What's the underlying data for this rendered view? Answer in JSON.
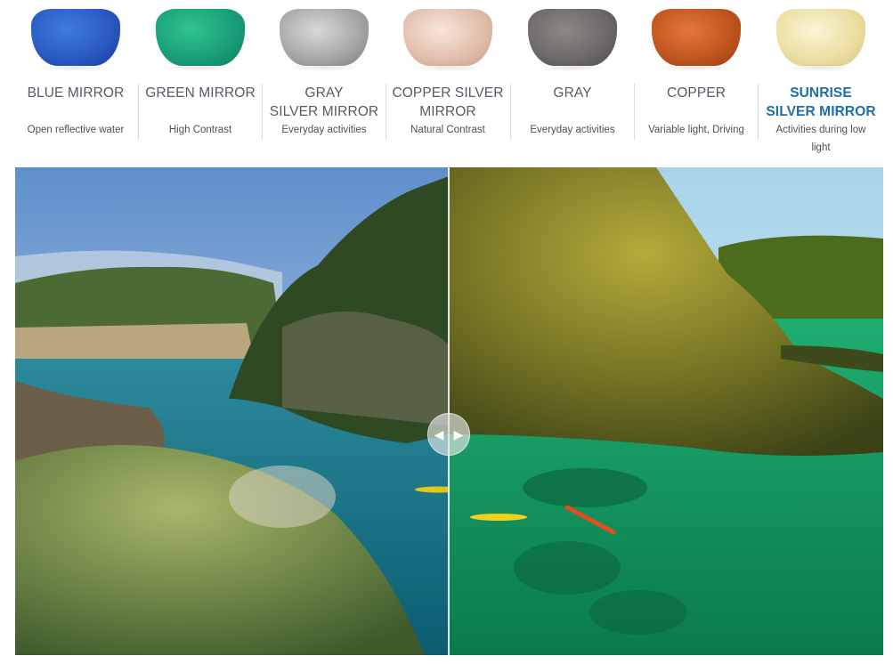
{
  "lenses": [
    {
      "name_lines": [
        "BLUE MIRROR"
      ],
      "desc_lines": [
        "Open reflective water"
      ],
      "color": "#2d5fc4",
      "active": false
    },
    {
      "name_lines": [
        "GREEN MIRROR"
      ],
      "desc_lines": [
        "High Contrast"
      ],
      "color": "#1fa07a",
      "active": false
    },
    {
      "name_lines": [
        "GRAY",
        "SILVER MIRROR"
      ],
      "desc_lines": [
        "Everyday activities"
      ],
      "color": "#9c9c9c",
      "active": false
    },
    {
      "name_lines": [
        "COPPER SILVER",
        "MIRROR"
      ],
      "desc_lines": [
        "Natural Contrast"
      ],
      "color": "#e2bfae",
      "active": false
    },
    {
      "name_lines": [
        "GRAY"
      ],
      "desc_lines": [
        "Everyday activities"
      ],
      "color": "#6e6c6b",
      "active": false
    },
    {
      "name_lines": [
        "COPPER"
      ],
      "desc_lines": [
        "Variable light, Driving"
      ],
      "color": "#c1561f",
      "active": false
    },
    {
      "name_lines": [
        "SUNRISE",
        "SILVER MIRROR"
      ],
      "desc_lines": [
        "Activities during low",
        "light"
      ],
      "color": "#ece0a0",
      "active": true
    }
  ],
  "comparison": {
    "handle_left_glyph": "◀",
    "handle_right_glyph": "▶",
    "icon_names": [
      "arrow-left-icon",
      "arrow-right-icon"
    ]
  }
}
